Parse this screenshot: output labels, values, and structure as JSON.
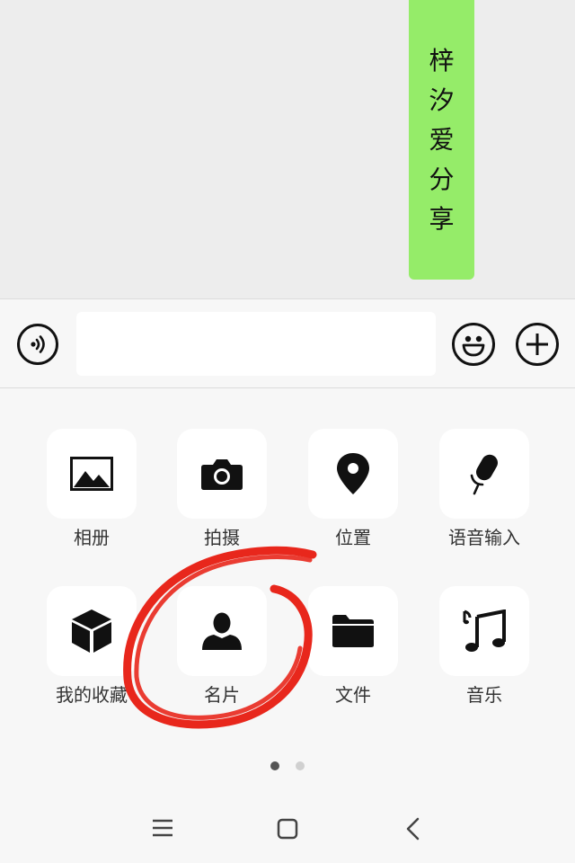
{
  "chat": {
    "bubble_chars": [
      "梓",
      "汐",
      "爱",
      "分",
      "享"
    ]
  },
  "input_bar": {
    "voice_icon": "voice-icon",
    "emoji_icon": "emoji-icon",
    "plus_icon": "plus-icon",
    "input_value": ""
  },
  "panel": {
    "items": [
      {
        "label": "相册",
        "icon": "image-icon"
      },
      {
        "label": "拍摄",
        "icon": "camera-icon"
      },
      {
        "label": "位置",
        "icon": "location-pin-icon"
      },
      {
        "label": "语音输入",
        "icon": "microphone-icon"
      },
      {
        "label": "我的收藏",
        "icon": "cube-icon"
      },
      {
        "label": "名片",
        "icon": "contact-card-icon"
      },
      {
        "label": "文件",
        "icon": "folder-icon"
      },
      {
        "label": "音乐",
        "icon": "music-note-icon"
      }
    ],
    "page_dots": {
      "count": 2,
      "active": 0
    }
  },
  "navbar": {
    "menu_icon": "menu-icon",
    "home_icon": "home-square-icon",
    "back_icon": "back-chevron-icon"
  },
  "colors": {
    "bubble": "#95ec69",
    "chat_bg": "#ededed",
    "panel_bg": "#f7f7f7",
    "annotation": "#e8271c"
  }
}
